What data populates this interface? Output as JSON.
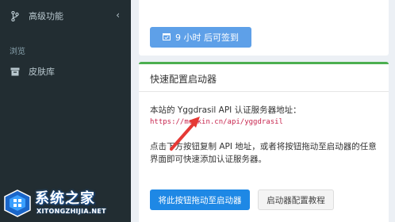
{
  "sidebar": {
    "advanced_label": "高级功能",
    "section_header": "浏览",
    "skin_label": "皮肤库"
  },
  "checkin": {
    "button_label": "9 小时 后可签到"
  },
  "launcher_box": {
    "title": "快速配置启动器",
    "api_line": "本站的 Yggdrasil API 认证服务器地址：",
    "api_url": "https://mcskin.cn/api/yggdrasil",
    "instructions": "点击下方按钮复制 API 地址，或者将按钮拖动至启动器的任意界面即可快速添加认证服务器。",
    "drag_button": "将此按钮拖动至启动器",
    "tutorial_button": "启动器配置教程"
  },
  "watermark": {
    "title": "系统之家",
    "subtitle": "XITONGZHIJIA.NET"
  },
  "colors": {
    "sidebar_bg": "#222d32",
    "box_accent": "#4caf50",
    "primary": "#1e88e5",
    "url": "#c7254e",
    "arrow": "#e53935"
  }
}
